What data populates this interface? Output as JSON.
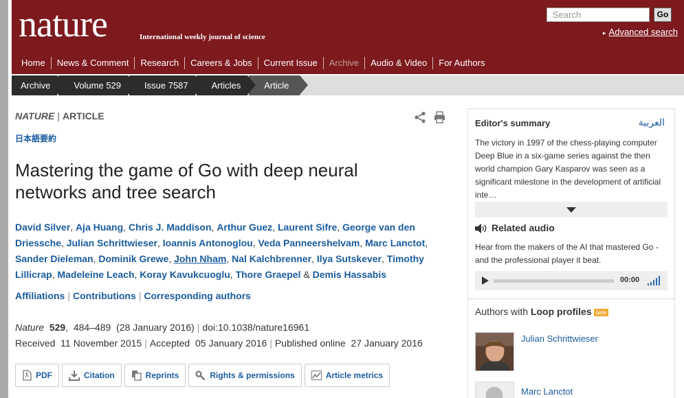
{
  "header": {
    "logo": "nature",
    "tagline": "International weekly journal of science",
    "search_placeholder": "Search",
    "go_label": "Go",
    "advanced_search": "Advanced search"
  },
  "nav": {
    "items": [
      "Home",
      "News & Comment",
      "Research",
      "Careers & Jobs",
      "Current Issue",
      "Archive",
      "Audio & Video",
      "For Authors"
    ]
  },
  "breadcrumb": [
    "Archive",
    "Volume 529",
    "Issue 7587",
    "Articles",
    "Article"
  ],
  "article": {
    "journal": "NATURE",
    "type": "ARTICLE",
    "japanese_summary": "日本語要約",
    "title": "Mastering the game of Go with deep neural networks and tree search",
    "authors": [
      "David Silver",
      "Aja Huang",
      "Chris J. Maddison",
      "Arthur Guez",
      "Laurent Sifre",
      "George van den Driessche",
      "Julian Schrittwieser",
      "Ioannis Antonoglou",
      "Veda Panneershelvam",
      "Marc Lanctot",
      "Sander Dieleman",
      "Dominik Grewe",
      "John Nham",
      "Nal Kalchbrenner",
      "Ilya Sutskever",
      "Timothy Lillicrap",
      "Madeleine Leach",
      "Koray Kavukcuoglu",
      "Thore Graepel",
      "Demis Hassabis"
    ],
    "affiliation_links": [
      "Affiliations",
      "Contributions",
      "Corresponding authors"
    ],
    "citation": {
      "journal": "Nature",
      "volume": "529",
      "pages": "484–489",
      "date": "(28 January 2016)",
      "doi": "doi:10.1038/nature16961"
    },
    "dates": {
      "received_label": "Received",
      "received": "11 November 2015",
      "accepted_label": "Accepted",
      "accepted": "05 January 2016",
      "published_label": "Published online",
      "published": "27 January 2016"
    },
    "tools": [
      "PDF",
      "Citation",
      "Reprints",
      "Rights & permissions",
      "Article metrics"
    ]
  },
  "sidebar": {
    "editors_summary": "Editor's summary",
    "arabic": "العربية",
    "summary_text": "The victory in 1997 of the chess-playing computer Deep Blue in a six-game series against the then world champion Gary Kasparov was seen as a significant milestone in the development of artificial inte…",
    "related_audio": "Related audio",
    "audio_text": "Hear from the makers of the AI that mastered Go - and the professional player it beat.",
    "audio_time": "00:00",
    "loop_prefix": "Authors with",
    "loop_bold": "Loop profiles",
    "beta": "beta",
    "profiles": [
      "Julian Schrittwieser",
      "Marc Lanctot"
    ]
  },
  "colors": {
    "masthead": "#7d1a1d",
    "link": "#1a5c9e",
    "breadcrumb": "#2c2c2c"
  }
}
